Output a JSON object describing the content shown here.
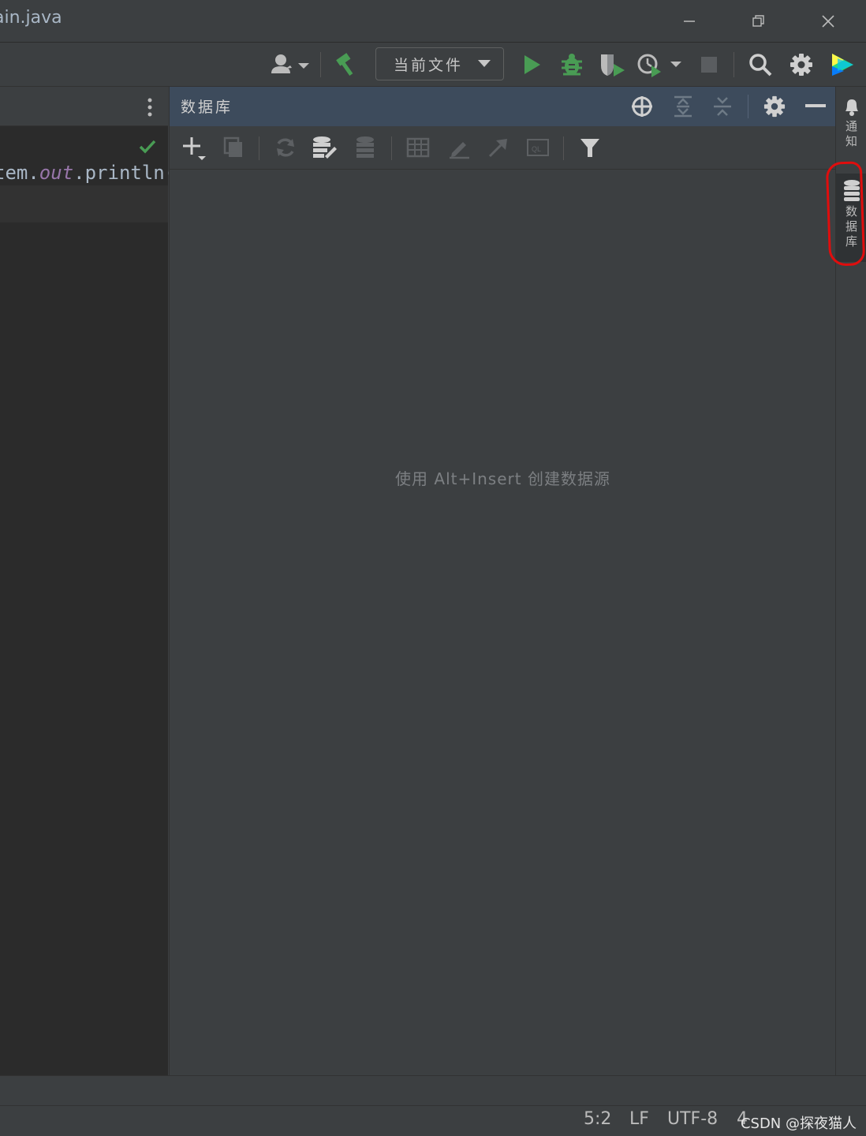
{
  "titlebar": {
    "title": "ain.java",
    "buttons": [
      "minimize",
      "restore",
      "close"
    ]
  },
  "toolbar": {
    "run_config_label": "当前文件",
    "icons": [
      "vcs-user-icon",
      "build-hammer-icon",
      "run-icon",
      "debug-icon",
      "coverage-icon",
      "profile-icon",
      "stop-icon",
      "search-icon",
      "settings-icon",
      "jetbrains-logo-icon"
    ]
  },
  "editor": {
    "code_prefix": "tem.",
    "code_keyword": "out",
    "code_suffix": ".println("
  },
  "database_panel": {
    "title": "数据库",
    "empty_hint": "使用 Alt+Insert 创建数据源",
    "header_icons": [
      "locate-icon",
      "expand-all-icon",
      "collapse-all-icon",
      "settings-icon",
      "hide-icon"
    ],
    "toolbar_icons": [
      "add-icon",
      "duplicate-icon",
      "refresh-icon",
      "data-source-properties-icon",
      "schemas-icon",
      "table-editor-icon",
      "edit-icon",
      "jump-to-source-icon",
      "query-console-icon",
      "filter-icon"
    ]
  },
  "right_stripe": {
    "notifications_label": "通知",
    "database_label": "数据库"
  },
  "statusbar": {
    "position": "5:2",
    "line_separator": "LF",
    "encoding": "UTF-8",
    "indent": "4",
    "watermark": "CSDN @探夜猫人"
  },
  "colors": {
    "accent_green": "#499c54",
    "panel_header": "#3d4b5c",
    "annotation_red": "#e00d0d"
  }
}
